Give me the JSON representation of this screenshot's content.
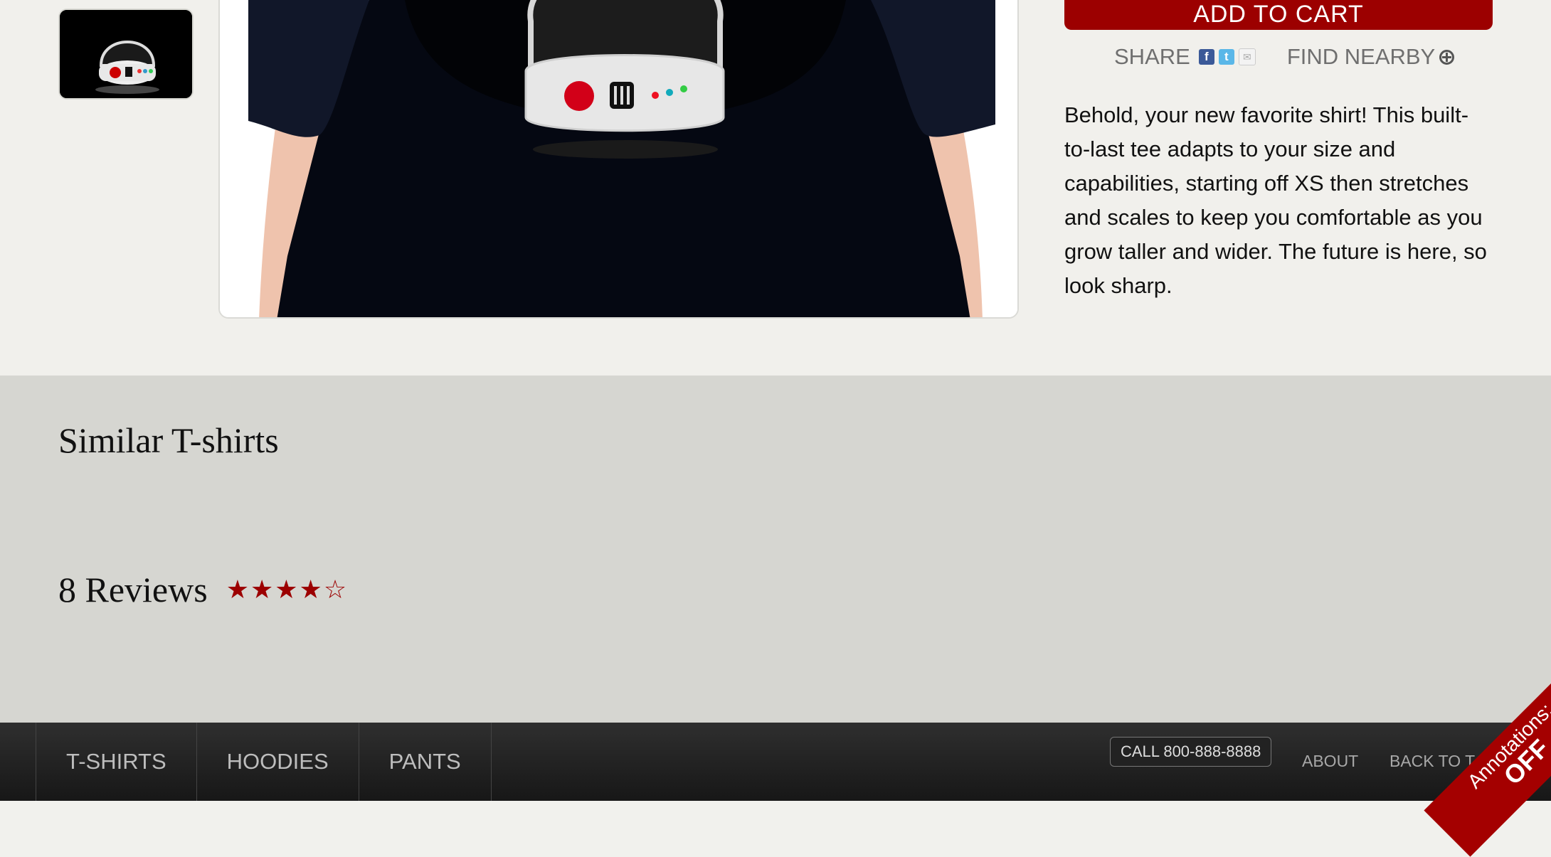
{
  "product": {
    "add_to_cart_label": "ADD TO CART",
    "share_label": "SHARE",
    "find_nearby_label": "FIND NEARBY",
    "description": "Behold, your new favorite shirt! This built-to-last tee adapts to your size and capabilities, starting off XS then stretches and scales to keep you comfortable as you grow taller and wider. The future is here, so look sharp."
  },
  "sections": {
    "similar_title": "Similar T-shirts",
    "reviews_title": "8 Reviews",
    "rating": {
      "value": 4,
      "max": 5,
      "stars": [
        "★",
        "★",
        "★",
        "★",
        "☆"
      ]
    }
  },
  "footer": {
    "nav": [
      "T-SHIRTS",
      "HOODIES",
      "PANTS"
    ],
    "call_label": "CALL 800-888-8888",
    "about_label": "ABOUT",
    "back_to_top_label": "BACK TO T",
    "annotation_label": "Annotations:",
    "annotation_state": "OFF"
  },
  "colors": {
    "accent": "#9c0000",
    "background": "#f1f0ec",
    "band": "#d6d6d1",
    "footer": "#222222"
  },
  "icons": [
    "facebook-icon",
    "twitter-icon",
    "mail-icon",
    "target-icon"
  ]
}
